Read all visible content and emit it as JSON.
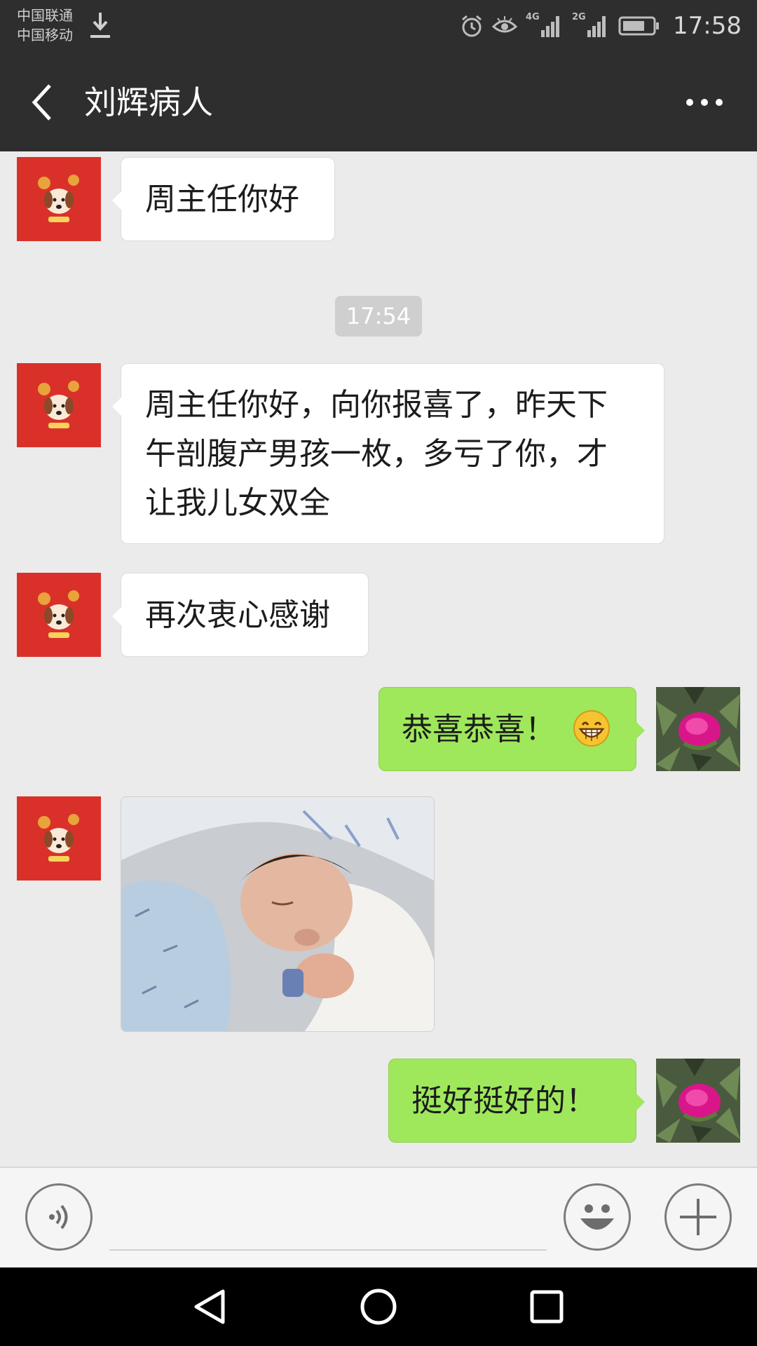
{
  "status_bar": {
    "carrier_1": "中国联通",
    "carrier_2": "中国移动",
    "network_1": "4G",
    "network_2": "2G",
    "time": "17:58",
    "icons": [
      "download-icon",
      "alarm-icon",
      "eye-icon",
      "signal-icon",
      "battery-icon"
    ]
  },
  "header": {
    "title": "刘辉病人",
    "back_icon": "chevron-left-icon",
    "more_icon": "more-dots-icon"
  },
  "messages": [
    {
      "side": "left",
      "type": "text",
      "text": "周主任你好"
    },
    {
      "type": "timestamp",
      "text": "17:54"
    },
    {
      "side": "left",
      "type": "text",
      "lines": [
        "周主任你好，向你报喜了，昨天下",
        "午剖腹产男孩一枚，多亏了你，才",
        "让我儿女双全"
      ]
    },
    {
      "side": "left",
      "type": "text",
      "text": "再次衷心感谢"
    },
    {
      "side": "right",
      "type": "text",
      "text": "恭喜恭喜！",
      "emoji": "grin-emoji"
    },
    {
      "side": "left",
      "type": "image",
      "alt": "newborn-photo"
    },
    {
      "side": "right",
      "type": "text",
      "text": "挺好挺好的！"
    }
  ],
  "input_bar": {
    "voice_icon": "voice-icon",
    "emoji_icon": "smiley-icon",
    "plus_icon": "plus-icon"
  },
  "nav_bar": {
    "icons": [
      "back-triangle-icon",
      "home-circle-icon",
      "recents-square-icon"
    ]
  },
  "colors": {
    "bar": "#2e2e2e",
    "chat_bg": "#ebebeb",
    "sent_bubble": "#9fe85c",
    "received_bubble": "#ffffff",
    "avatar_red": "#d9312a"
  }
}
